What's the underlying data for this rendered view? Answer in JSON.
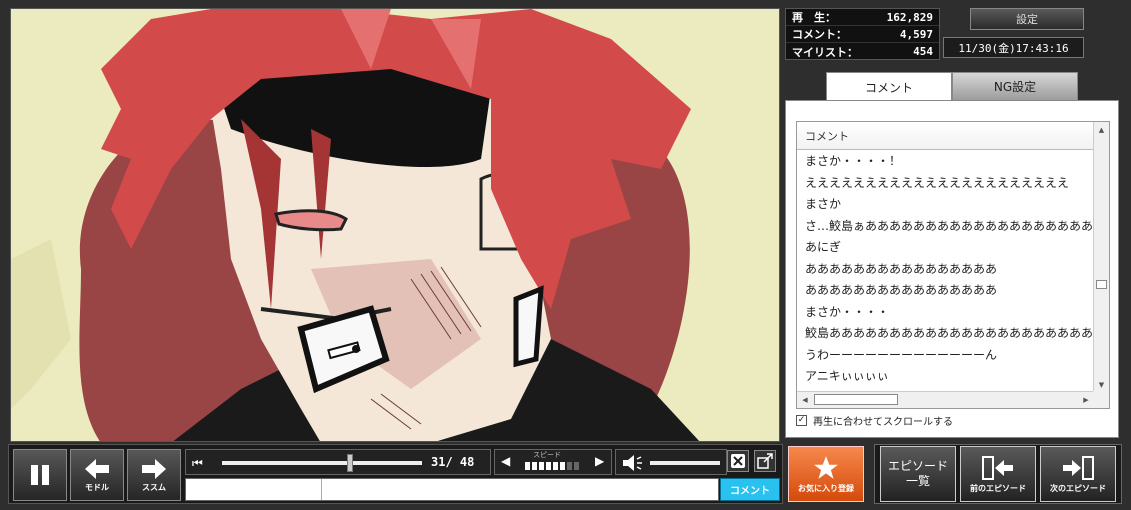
{
  "stats": {
    "views_label": "再　生：",
    "views": "162,829",
    "comments_label": "コメント：",
    "comments": "4,597",
    "mylist_label": "マイリスト：",
    "mylist": "454"
  },
  "settings_label": "設定",
  "datetime": "11/30(金)17:43:16",
  "tabs": {
    "comment": "コメント",
    "ng": "NG設定"
  },
  "comment_list": {
    "header": "コメント",
    "rows": [
      "まさか・・・・！",
      "ええええええええええええええええええええええ",
      "まさか",
      "さ…鮫島ぁああああああああああああああああああああ",
      "あにぎ",
      "ああああああああああああああああ",
      "ああああああああああああああああ",
      "まさか・・・・",
      "鮫島あああああああああああああああああああああああ",
      "うわーーーーーーーーーーーーーん",
      "アニキぃぃぃぃ"
    ]
  },
  "autoscroll_label": "再生に合わせてスクロールする",
  "player": {
    "back_label": "モドル",
    "forward_label": "ススム",
    "position": "31/ 48",
    "speed_title": "スピード",
    "seek_fraction": 0.64,
    "speed_level": 6,
    "speed_max": 8,
    "volume_fraction": 1.0,
    "comment_submit": "コメント",
    "comment_placeholder": ""
  },
  "buttons": {
    "favorite": "お気に入り登録",
    "episode_list_line1": "エピソード",
    "episode_list_line2": "一覧",
    "prev_episode": "前のエピソード",
    "next_episode": "次のエピソード"
  },
  "colors": {
    "favorite": "#e8611f",
    "submit": "#29c1f0",
    "hair": "#d24a4a"
  },
  "icons": [
    "pause-icon",
    "back-arrow-icon",
    "forward-arrow-icon",
    "skip-start-icon",
    "speaker-icon",
    "close-x-icon",
    "popout-icon",
    "star-icon",
    "prev-episode-icon",
    "next-episode-icon"
  ]
}
